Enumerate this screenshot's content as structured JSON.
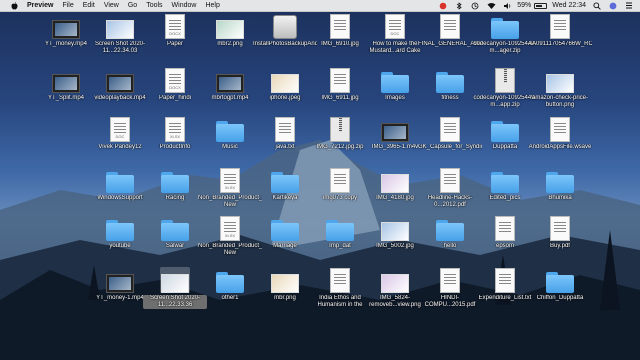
{
  "menubar": {
    "app_name": "Preview",
    "menus": [
      "File",
      "Edit",
      "View",
      "Go",
      "Tools",
      "Window",
      "Help"
    ],
    "battery_percent": "59%",
    "clock": "Wed 22:34"
  },
  "desktop_items": [
    {
      "label": "YT_money.mp4",
      "kind": "video"
    },
    {
      "label": "Screen Shot 2020-11...22.34.03",
      "kind": "image"
    },
    {
      "label": "Paper",
      "kind": "doc",
      "badge": "DOCX"
    },
    {
      "label": "mbr2.png",
      "kind": "image"
    },
    {
      "label": "InstallPhotosBackupAndSync.dmg",
      "kind": "disk"
    },
    {
      "label": "IMG_6910.jpg",
      "kind": "doc"
    },
    {
      "label": "How to make the Mustard...ard Cake",
      "kind": "doc",
      "badge": "DOC"
    },
    {
      "label": "FINAL_GENERAL_AWARENE...ndi).pdf",
      "kind": "doc"
    },
    {
      "label": "codecanyon-10925449-m...ager.zip",
      "kind": "folder"
    },
    {
      "label": "AA091117054766W_RC23112017.pdf",
      "kind": "doc"
    },
    {
      "label": "YT_Split.mp4",
      "kind": "video"
    },
    {
      "label": "videoplayback.mp4",
      "kind": "video"
    },
    {
      "label": "Paper_hindi",
      "kind": "doc",
      "badge": "DOCX"
    },
    {
      "label": "mbrtogpt.mp4",
      "kind": "video"
    },
    {
      "label": "iphone.jpeg",
      "kind": "image"
    },
    {
      "label": "IMG_6911.jpg",
      "kind": "doc"
    },
    {
      "label": "Images",
      "kind": "folder"
    },
    {
      "label": "fitness",
      "kind": "folder"
    },
    {
      "label": "codecanyon-10925449-m...app.zip",
      "kind": "zip"
    },
    {
      "label": "amazon-check-price-button.png",
      "kind": "image"
    },
    {
      "label": "Vivek Pandey12",
      "kind": "doc",
      "badge": "DOC"
    },
    {
      "label": "ProductInfo",
      "kind": "doc",
      "badge": "XLSX"
    },
    {
      "label": "Music",
      "kind": "folder"
    },
    {
      "label": "java.txt",
      "kind": "doc"
    },
    {
      "label": "IMG_7212.jpg.zip",
      "kind": "zip"
    },
    {
      "label": "IMG_3965-1.m4v",
      "kind": "video"
    },
    {
      "label": "GK_Capsule_for_Syndicate_...Hindi.pdf",
      "kind": "doc"
    },
    {
      "label": "Duppatta",
      "kind": "folder"
    },
    {
      "label": "AndroidAppsFile.wsave",
      "kind": "doc"
    },
    {
      "label": "WindowsSupport",
      "kind": "folder"
    },
    {
      "label": "Racing",
      "kind": "folder"
    },
    {
      "label": "Non_Branded_Product_List_...late New",
      "kind": "doc",
      "badge": "XLSX"
    },
    {
      "label": "Kartikeya",
      "kind": "folder"
    },
    {
      "label": "img073 copy",
      "kind": "doc"
    },
    {
      "label": "IMG_4180.jpg",
      "kind": "image"
    },
    {
      "label": "Headline-Hacks-0...2012.pdf",
      "kind": "doc"
    },
    {
      "label": "Edited_pics",
      "kind": "folder"
    },
    {
      "label": "Bhumika",
      "kind": "folder"
    },
    {
      "label": "youtube",
      "kind": "folder"
    },
    {
      "label": "Salwar",
      "kind": "folder"
    },
    {
      "label": "Non_Branded_Product_List_...late New",
      "kind": "doc",
      "badge": "XLSX"
    },
    {
      "label": "Marriage",
      "kind": "folder"
    },
    {
      "label": "Imp_dat",
      "kind": "folder"
    },
    {
      "label": "IMG_5002.jpg",
      "kind": "image"
    },
    {
      "label": "hello",
      "kind": "folder"
    },
    {
      "label": "epsom",
      "kind": "doc"
    },
    {
      "label": "Buy.pdf",
      "kind": "doc"
    },
    {
      "label": "YT_money-1.mp4",
      "kind": "video"
    },
    {
      "label": "Screen Shot 2020-11...22.33.36",
      "kind": "image",
      "selected": true
    },
    {
      "label": "other1",
      "kind": "folder"
    },
    {
      "label": "mbr.png",
      "kind": "image"
    },
    {
      "label": "India Ethos and Humanism in the",
      "kind": "doc"
    },
    {
      "label": "IMG_5824-removeb...view.png",
      "kind": "image"
    },
    {
      "label": "HINDI-COMPU...2015.pdf",
      "kind": "doc"
    },
    {
      "label": "Expenditure_List.txt",
      "kind": "doc"
    },
    {
      "label": "Chiffon_Duppatta",
      "kind": "folder"
    }
  ]
}
